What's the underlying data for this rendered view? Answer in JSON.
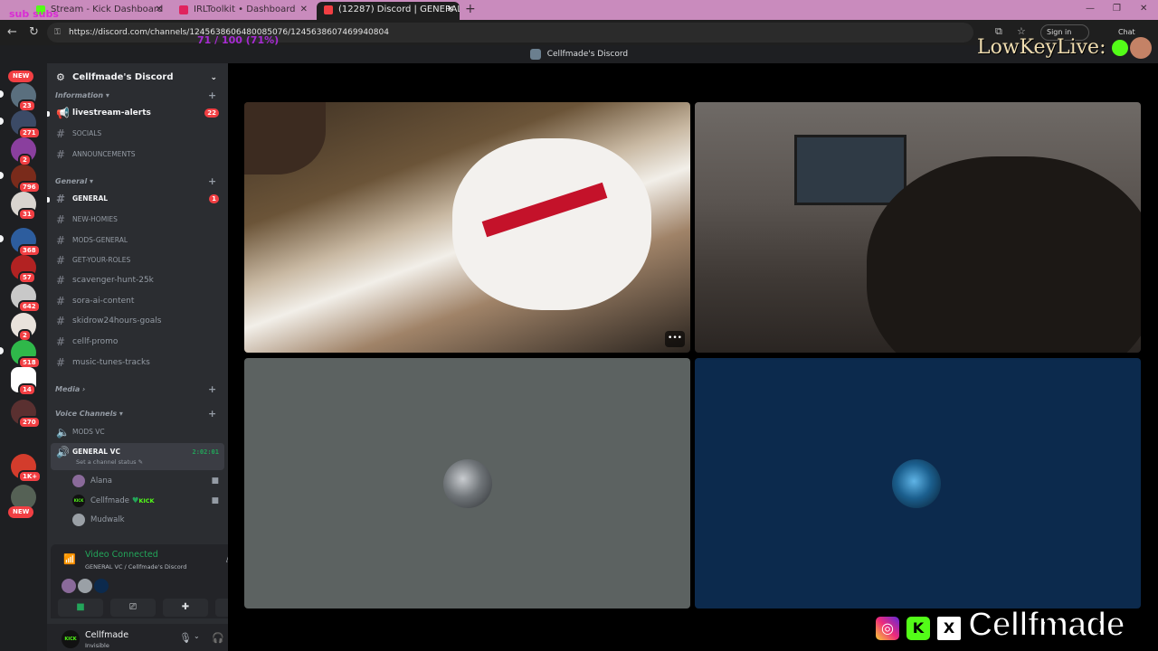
{
  "browser": {
    "tabs": [
      {
        "label": "Stream - Kick Dashboard",
        "color": "#53fc18"
      },
      {
        "label": "IRLToolkit • Dashboard",
        "color": "#e0245e"
      },
      {
        "label": "(12287) Discord | GENERAL VC",
        "color": "#f23f43"
      }
    ],
    "url": "https://discord.com/channels/1245638606480085076/1245638607469940804",
    "sign_in": "Sign in",
    "chat": "Chat"
  },
  "overlay": {
    "subs_text": "sub subs",
    "goal_text": "71 / 100 (71%)",
    "lowkey_text": "LowKeyLive:",
    "brand_name": "Cellfmade",
    "brand_x": "X",
    "brand_k": "K"
  },
  "discord": {
    "window_title": "Cellfmade's Discord",
    "server_name": "Cellfmade's Discord",
    "servers": [
      {
        "badge": "23"
      },
      {
        "badge": "271"
      },
      {
        "badge": "2"
      },
      {
        "badge": "796"
      },
      {
        "badge": "31"
      },
      {
        "badge": "368"
      },
      {
        "badge": "57"
      },
      {
        "badge": "642"
      },
      {
        "badge": "2"
      },
      {
        "badge": "518"
      },
      {
        "badge": "14"
      },
      {
        "badge": "270"
      },
      {
        "badge": "1K+"
      },
      {
        "badge": ""
      }
    ],
    "new_label": "NEW",
    "categories": {
      "information": "Information",
      "general": "General",
      "media": "Media",
      "voice": "Voice Channels"
    },
    "channels": {
      "livestream_alerts": "livestream-alerts",
      "livestream_badge": "22",
      "socials": "SOCIALS",
      "announcements": "ANNOUNCEMENTS",
      "general": "GENERAL",
      "general_badge": "1",
      "new_homies": "NEW-HOMIES",
      "mods_general": "MODS-GENERAL",
      "get_your_roles": "GET-YOUR-ROLES",
      "scavenger": "scavenger-hunt-25k",
      "sora": "sora-ai-content",
      "skidrow": "skidrow24hours-goals",
      "cellf_promo": "cellf-promo",
      "music": "music-tunes-tracks",
      "mods_vc": "MODS VC",
      "general_vc": "GENERAL VC",
      "general_vc_time": "2:02:01",
      "general_vc_status": "Set a channel status"
    },
    "voice_members": [
      {
        "name": "Alana"
      },
      {
        "name": "Cellfmade",
        "tag": "KICK",
        "prefix": "KICK"
      },
      {
        "name": "Mudwalk"
      }
    ],
    "voice_panel": {
      "title": "Video Connected",
      "subtitle": "GENERAL VC / Cellfmade's Discord"
    },
    "user": {
      "name": "Cellfmade",
      "status": "Invisible",
      "avatar_text": "KICK"
    },
    "colors": {
      "online": "#23a55a",
      "badge": "#f23f43",
      "kick": "#53fc18"
    }
  }
}
